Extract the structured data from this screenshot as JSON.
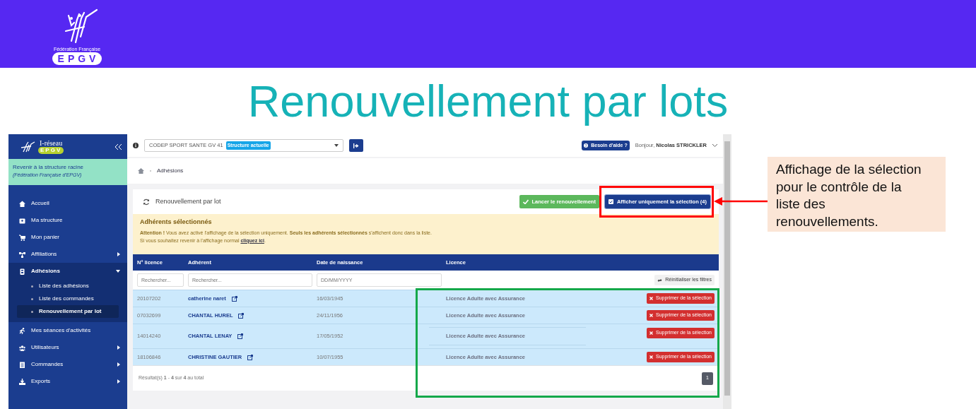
{
  "banner": {
    "logo_caption": "Fédération Française",
    "logo_letters": "EPGV"
  },
  "slide_title": "Renouvellement par lots",
  "app": {
    "sidebar": {
      "brand": "I-réseau",
      "brand_badge": "EPGV",
      "root_link": {
        "label": "Revenir à la structure racine",
        "sublabel": "(Fédération Française d'EPGV)"
      },
      "items": [
        {
          "label": "Accueil",
          "selected": false
        },
        {
          "label": "Ma structure",
          "selected": false
        },
        {
          "label": "Mon panier",
          "selected": false
        },
        {
          "label": "Affiliations",
          "selected": false,
          "expanded": false
        },
        {
          "label": "Adhésions",
          "selected": true,
          "expanded": true,
          "children": [
            {
              "label": "Liste des adhésions",
              "selected": false
            },
            {
              "label": "Liste des commandes",
              "selected": false
            },
            {
              "label": "Renouvellement par lot",
              "selected": true
            }
          ]
        },
        {
          "label": "Mes séances d'activités",
          "selected": false
        },
        {
          "label": "Utilisateurs",
          "selected": false,
          "expanded": false
        },
        {
          "label": "Commandes",
          "selected": false,
          "expanded": false
        },
        {
          "label": "Exports",
          "selected": false,
          "expanded": false
        }
      ]
    },
    "topbar": {
      "structure": "CODEP SPORT SANTE GV 41",
      "structure_badge": "Structure actuelle",
      "help": "Besoin d'aide ?",
      "greeting": "Bonjour, **Nicolas STRICKLER**"
    },
    "breadcrumb": [
      "Adhésions"
    ],
    "card": {
      "title": "Renouvellement par lot",
      "buttons": [
        {
          "label": "Lancer le renouvellement",
          "kind": "success"
        },
        {
          "label": "Afficher uniquement la sélection (4)",
          "kind": "primary"
        }
      ],
      "alert": {
        "title": "Adhérents sélectionnés",
        "message": "**Attention !** Vous avez activé l'affichage de la sélection uniquement. **Seuls les adhérents sélectionnés** s'affichent donc dans la liste.",
        "hint": "Si vous souhaitez revenir à l'affichage normal",
        "link": "cliquez ici",
        "hint_end": "."
      },
      "table": {
        "columns": [
          "N° licence",
          "Adhérent",
          "Date de naissance",
          "Licence"
        ],
        "filters": [
          {
            "placeholder": "Rechercher..."
          },
          {
            "placeholder": "Rechercher..."
          },
          {
            "placeholder": "DD/MM/YYYY"
          }
        ],
        "reset": "Réinitialiser les filtres",
        "rows": [
          {
            "licence_no": "20107202",
            "member": "catherine naret",
            "birth_date": "16/03/1945",
            "licence": "Licence Adulte avec Assurance",
            "action": "Supprimer de la sélection",
            "selected": true,
            "kind": "plain"
          },
          {
            "licence_no": "07032699",
            "member": "CHANTAL HUREL",
            "birth_date": "24/11/1956",
            "licence": "Licence Adulte avec Assurance",
            "action": "Supprimer de la sélection",
            "selected": true,
            "kind": "plain"
          },
          {
            "licence_no": "14014240",
            "member": "CHANTAL LENAY",
            "birth_date": "17/05/1952",
            "licence": "Licence Adulte avec Assurance",
            "action": "Supprimer de la sélection",
            "selected": true,
            "kind": "ruled"
          },
          {
            "licence_no": "18106846",
            "member": "CHRISTINE GAUTIER",
            "birth_date": "10/07/1955",
            "licence": "Licence Adulte avec Assurance",
            "action": "Supprimer de la sélection",
            "selected": true,
            "kind": "plain"
          }
        ]
      },
      "summary": "Résultat(s) **1** - **4** sur **4** au total",
      "pages": [
        {
          "label": "1",
          "selected": true
        }
      ]
    }
  },
  "callout": "Affichage de la sélection pour le contrôle de la liste des renouvellements."
}
